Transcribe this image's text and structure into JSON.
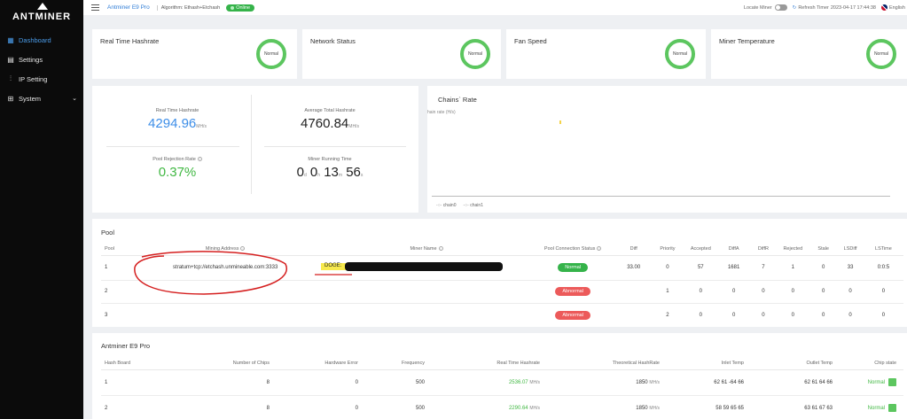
{
  "brand": {
    "logo_text": "ANTMINER"
  },
  "sidebar": {
    "items": [
      {
        "label": "Dashboard",
        "icon": "dashboard-icon",
        "active": true
      },
      {
        "label": "Settings",
        "icon": "settings-icon",
        "active": false
      },
      {
        "label": "IP Setting",
        "icon": "sliders-icon",
        "active": false
      },
      {
        "label": "System",
        "icon": "system-icon",
        "active": false
      }
    ]
  },
  "topbar": {
    "model": "Antminer E9 Pro",
    "algorithm": "Algorithm: Ethash+Etchash",
    "status": "Online",
    "locate_label": "Locate Miner",
    "refresh_label": "Refresh Timer",
    "timestamp": "2023-04-17 17:44:38",
    "language": "English"
  },
  "status_cards": [
    {
      "title": "Real Time Hashrate",
      "state": "Normal"
    },
    {
      "title": "Network Status",
      "state": "Normal"
    },
    {
      "title": "Fan Speed",
      "state": "Normal"
    },
    {
      "title": "Miner Temperature",
      "state": "Normal"
    }
  ],
  "stats": {
    "rt_hash_label": "Real Time Hashrate",
    "rt_hash_value": "4294.96",
    "rt_hash_unit": "MH/s",
    "avg_hash_label": "Average Total Hashrate",
    "avg_hash_value": "4760.84",
    "avg_hash_unit": "MH/s",
    "reject_label": "Pool Rejection Rate",
    "reject_value": "0.37%",
    "runtime_label": "Miner Running Time",
    "runtime_d": "0",
    "runtime_h": "0",
    "runtime_m": "13",
    "runtime_s": "56",
    "u_d": "d",
    "u_h": "h",
    "u_m": "m",
    "u_s": "s"
  },
  "chart": {
    "title": "Chains` Rate",
    "ylabel": "hain rate (H/s)",
    "legend": [
      "chain0",
      "chain1"
    ]
  },
  "chart_data": {
    "type": "line",
    "title": "Chains` Rate",
    "ylabel": "hain rate (H/s)",
    "series": [
      {
        "name": "chain0",
        "values": []
      },
      {
        "name": "chain1",
        "values": []
      }
    ]
  },
  "pool": {
    "title": "Pool",
    "headers": [
      "Pool",
      "Mining Address",
      "Miner Name",
      "Pool Connection Status",
      "Diff",
      "Priority",
      "Accepted",
      "DiffA",
      "DiffR",
      "Rejected",
      "Stale",
      "LSDiff",
      "LSTime"
    ],
    "rows": [
      {
        "pool": "1",
        "address": "stratum+tcp://etchash.unmineable.com:3333",
        "miner": "DOGE:",
        "status": "Normal",
        "diff": "33.00",
        "priority": "0",
        "accepted": "57",
        "diffa": "1681",
        "diffr": "7",
        "rejected": "1",
        "stale": "0",
        "lsdiff": "33",
        "lstime": "0:0:5"
      },
      {
        "pool": "2",
        "address": "",
        "miner": "",
        "status": "Abnormal",
        "diff": "",
        "priority": "1",
        "accepted": "0",
        "diffa": "0",
        "diffr": "0",
        "rejected": "0",
        "stale": "0",
        "lsdiff": "0",
        "lstime": "0"
      },
      {
        "pool": "3",
        "address": "",
        "miner": "",
        "status": "Abnormal",
        "diff": "",
        "priority": "2",
        "accepted": "0",
        "diffa": "0",
        "diffr": "0",
        "rejected": "0",
        "stale": "0",
        "lsdiff": "0",
        "lstime": "0"
      }
    ]
  },
  "boards": {
    "title": "Antminer E9 Pro",
    "headers": [
      "Hash Board",
      "Number of Chips",
      "Hardware Error",
      "Frequency",
      "Real Time Hashrate",
      "Theoretical HashRate",
      "Inlet Temp",
      "Outlet Temp",
      "Chip state"
    ],
    "rows": [
      {
        "board": "1",
        "chips": "8",
        "hw": "0",
        "freq": "500",
        "rt": "2536.07",
        "rt_unit": "MH/s",
        "th": "1850",
        "th_unit": "MH/s",
        "inlet": "62 61 -64 66",
        "outlet": "62 61 64 66",
        "state": "Normal"
      },
      {
        "board": "2",
        "chips": "8",
        "hw": "0",
        "freq": "500",
        "rt": "2290.64",
        "rt_unit": "MH/s",
        "th": "1850",
        "th_unit": "MH/s",
        "inlet": "58 59 65 65",
        "outlet": "63 61 67 63",
        "state": "Normal"
      }
    ]
  },
  "colors": {
    "accent": "#3d8ee8",
    "ok": "#35b34a",
    "bad": "#ec5a5a",
    "sidebar": "#0b0b0b"
  }
}
